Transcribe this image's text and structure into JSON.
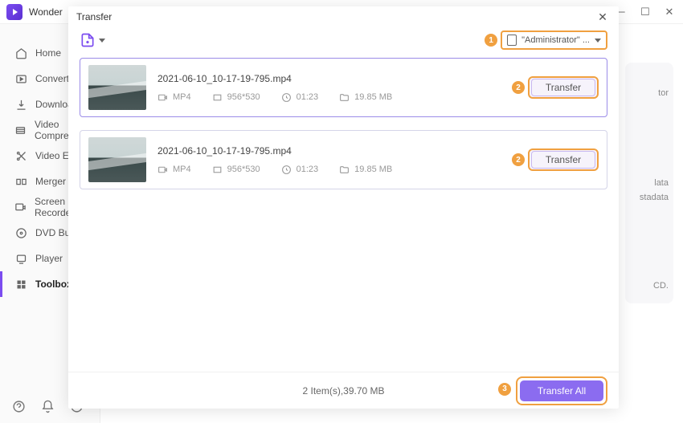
{
  "app_name": "Wonder",
  "sidebar": {
    "items": [
      {
        "label": "Home"
      },
      {
        "label": "Converter"
      },
      {
        "label": "Download"
      },
      {
        "label": "Video Compressor"
      },
      {
        "label": "Video Editor"
      },
      {
        "label": "Merger"
      },
      {
        "label": "Screen Recorder"
      },
      {
        "label": "DVD Burner"
      },
      {
        "label": "Player"
      },
      {
        "label": "Toolbox"
      }
    ]
  },
  "bg": {
    "t1": "tor",
    "t2": "lata",
    "t3": "stadata",
    "t4": "CD."
  },
  "dialog": {
    "title": "Transfer",
    "device_label": "\"Administrator\" ...",
    "callout1": "1",
    "callout2": "2",
    "callout3": "3",
    "files": [
      {
        "name": "2021-06-10_10-17-19-795.mp4",
        "format": "MP4",
        "resolution": "956*530",
        "duration": "01:23",
        "size": "19.85 MB",
        "transfer_label": "Transfer"
      },
      {
        "name": "2021-06-10_10-17-19-795.mp4",
        "format": "MP4",
        "resolution": "956*530",
        "duration": "01:23",
        "size": "19.85 MB",
        "transfer_label": "Transfer"
      }
    ],
    "summary": "2 Item(s),39.70 MB",
    "transfer_all_label": "Transfer All"
  }
}
